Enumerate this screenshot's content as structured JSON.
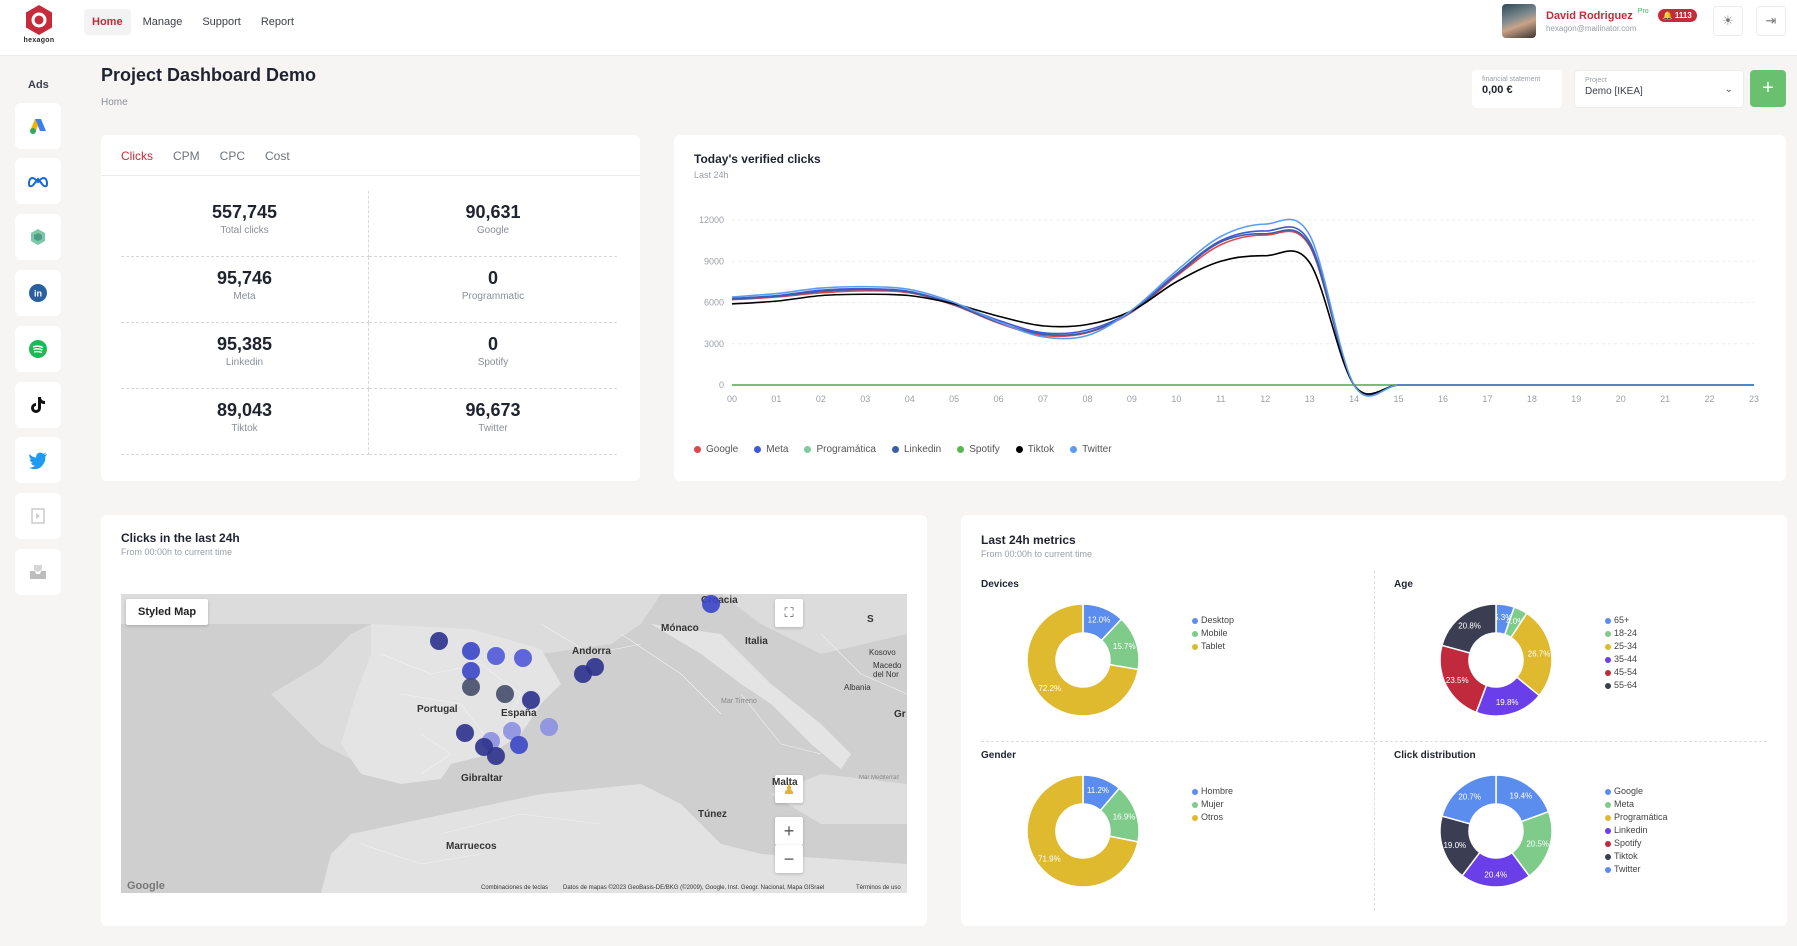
{
  "app": {
    "logo_text": "hexagon"
  },
  "nav": {
    "items": [
      {
        "label": "Home"
      },
      {
        "label": "Manage"
      },
      {
        "label": "Support"
      },
      {
        "label": "Report"
      }
    ]
  },
  "user": {
    "name": "David Rodriguez",
    "plan": "Pro",
    "notifications": "1113",
    "email": "hexagon@mailinator.com"
  },
  "sidebar": {
    "title": "Ads",
    "items": [
      "google-ads-icon",
      "meta-icon",
      "hexagon-icon",
      "linkedin-icon",
      "spotify-icon",
      "tiktok-icon",
      "twitter-icon",
      "programmatic-icon",
      "inbox-icon"
    ]
  },
  "header": {
    "title": "Project Dashboard Demo",
    "breadcrumb": "Home",
    "financial_label": "financial statement",
    "financial_value": "0,00 €",
    "project_label": "Project",
    "project_value": "Demo [IKEA]"
  },
  "stats": {
    "tabs": [
      {
        "label": "Clicks"
      },
      {
        "label": "CPM"
      },
      {
        "label": "CPC"
      },
      {
        "label": "Cost"
      }
    ],
    "items": [
      {
        "value": "557,745",
        "label": "Total clicks"
      },
      {
        "value": "90,631",
        "label": "Google"
      },
      {
        "value": "95,746",
        "label": "Meta"
      },
      {
        "value": "0",
        "label": "Programmatic"
      },
      {
        "value": "95,385",
        "label": "Linkedin"
      },
      {
        "value": "0",
        "label": "Spotify"
      },
      {
        "value": "89,043",
        "label": "Tiktok"
      },
      {
        "value": "96,673",
        "label": "Twitter"
      }
    ]
  },
  "line_card": {
    "title": "Today's verified clicks",
    "subtitle": "Last 24h"
  },
  "chart_data": [
    {
      "type": "line",
      "title": "Today's verified clicks",
      "x": [
        "00",
        "01",
        "02",
        "03",
        "04",
        "05",
        "06",
        "07",
        "08",
        "09",
        "10",
        "11",
        "12",
        "13",
        "14",
        "15",
        "16",
        "17",
        "18",
        "19",
        "20",
        "21",
        "22",
        "23"
      ],
      "ylim": [
        0,
        12000
      ],
      "yticks": [
        "0",
        "3000",
        "6000",
        "9000",
        "12000"
      ],
      "grid": true,
      "legend_position": "bottom-left",
      "series": [
        {
          "name": "Google",
          "color": "#e0464e",
          "values": [
            6200,
            6400,
            6700,
            6850,
            6700,
            5800,
            4500,
            3600,
            3800,
            5300,
            7900,
            10200,
            10900,
            10100,
            0,
            0,
            0,
            0,
            0,
            0,
            0,
            0,
            0,
            0
          ]
        },
        {
          "name": "Meta",
          "color": "#3f57d9",
          "values": [
            6300,
            6500,
            6900,
            7000,
            6800,
            5900,
            4700,
            3800,
            4000,
            5400,
            8100,
            10500,
            11200,
            10400,
            0,
            0,
            0,
            0,
            0,
            0,
            0,
            0,
            0,
            0
          ]
        },
        {
          "name": "Programática",
          "color": "#7ecb9d",
          "values": [
            0,
            0,
            0,
            0,
            0,
            0,
            0,
            0,
            0,
            0,
            0,
            0,
            0,
            0,
            0,
            0,
            0,
            0,
            0,
            0,
            0,
            0,
            0,
            0
          ]
        },
        {
          "name": "Linkedin",
          "color": "#3b5fa5",
          "values": [
            6250,
            6450,
            6800,
            6950,
            6750,
            5850,
            4550,
            3700,
            3850,
            5350,
            8000,
            10400,
            11000,
            10200,
            0,
            0,
            0,
            0,
            0,
            0,
            0,
            0,
            0,
            0
          ]
        },
        {
          "name": "Spotify",
          "color": "#5ab552",
          "values": [
            0,
            0,
            0,
            0,
            0,
            0,
            0,
            0,
            0,
            0,
            0,
            0,
            0,
            0,
            0,
            0,
            0,
            0,
            0,
            0,
            0,
            0,
            0,
            0
          ]
        },
        {
          "name": "Tiktok",
          "color": "#000000",
          "values": [
            5900,
            6100,
            6500,
            6600,
            6500,
            5900,
            5000,
            4300,
            4400,
            5400,
            7500,
            9000,
            9400,
            8900,
            0,
            0,
            0,
            0,
            0,
            0,
            0,
            0,
            0,
            0
          ]
        },
        {
          "name": "Twitter",
          "color": "#5b9cf2",
          "values": [
            6400,
            6650,
            7050,
            7150,
            6950,
            6000,
            4600,
            3500,
            3600,
            5450,
            8300,
            10800,
            11700,
            10900,
            0,
            0,
            0,
            0,
            0,
            0,
            0,
            0,
            0,
            0
          ]
        }
      ]
    },
    {
      "type": "pie",
      "title": "Devices",
      "labels": [
        "Desktop",
        "Mobile",
        "Tablet"
      ],
      "values": [
        12.0,
        15.7,
        72.2
      ],
      "colors": [
        "#5b8def",
        "#7ecb8a",
        "#dfb92e"
      ]
    },
    {
      "type": "pie",
      "title": "Age",
      "labels": [
        "65+",
        "18-24",
        "25-34",
        "35-44",
        "45-54",
        "55-64"
      ],
      "values": [
        5.3,
        4.0,
        26.7,
        19.8,
        23.5,
        20.8
      ],
      "colors": [
        "#5b8def",
        "#7ecb8a",
        "#dfb92e",
        "#6a3ee8",
        "#c02a3c",
        "#3b3e52"
      ]
    },
    {
      "type": "pie",
      "title": "Gender",
      "labels": [
        "Hombre",
        "Mujer",
        "Otros"
      ],
      "values": [
        11.2,
        16.9,
        71.9
      ],
      "colors": [
        "#5b8def",
        "#7ecb8a",
        "#dfb92e"
      ]
    },
    {
      "type": "pie",
      "title": "Click distribution",
      "labels": [
        "Google",
        "Meta",
        "Programática",
        "Linkedin",
        "Spotify",
        "Tiktok",
        "Twitter"
      ],
      "values": [
        19.4,
        20.5,
        0,
        20.4,
        0,
        19.0,
        20.7
      ],
      "colors": [
        "#5b8def",
        "#7ecb8a",
        "#dfb92e",
        "#6a3ee8",
        "#c02a3c",
        "#3b3e52",
        "#5b8def"
      ]
    }
  ],
  "map_card": {
    "title": "Clicks in the last 24h",
    "subtitle": "From 00:00h to current time",
    "style_button": "Styled Map",
    "labels": [
      "Croacia",
      "Mónaco",
      "Andorra",
      "Italia",
      "Portugal",
      "España",
      "Albania",
      "Kosovo",
      "Macedo del Nor",
      "Gibraltar",
      "Malta",
      "Túnez",
      "Marruecos",
      "Mar Tirreno",
      "Mar Mediterráneo",
      "S",
      "Gr"
    ],
    "footer": {
      "brand": "Google",
      "shortcuts": "Combinaciones de teclas",
      "attribution": "Datos de mapas ©2023 GeoBasis-DE/BKG (©2009), Google, Inst. Geogr. Nacional, Mapa GISrael",
      "terms": "Términos de uso"
    },
    "marker_colors": [
      "#2c318c",
      "#3b46c8",
      "#5058d8",
      "#444c6a",
      "#8b90e0"
    ]
  },
  "metrics_card": {
    "title": "Last 24h metrics",
    "subtitle": "From 00:00h to current time",
    "pie_labels": [
      "12.0%",
      "15.7%",
      "72.2%",
      "5.3%",
      "4.0%",
      "26.7%",
      "19.8%",
      "23.5%",
      "20.8%",
      "11.2%",
      "16.9%",
      "71.9%",
      "19.4%",
      "20.5%",
      "20.4%",
      "19.0%",
      "20.7%"
    ]
  }
}
